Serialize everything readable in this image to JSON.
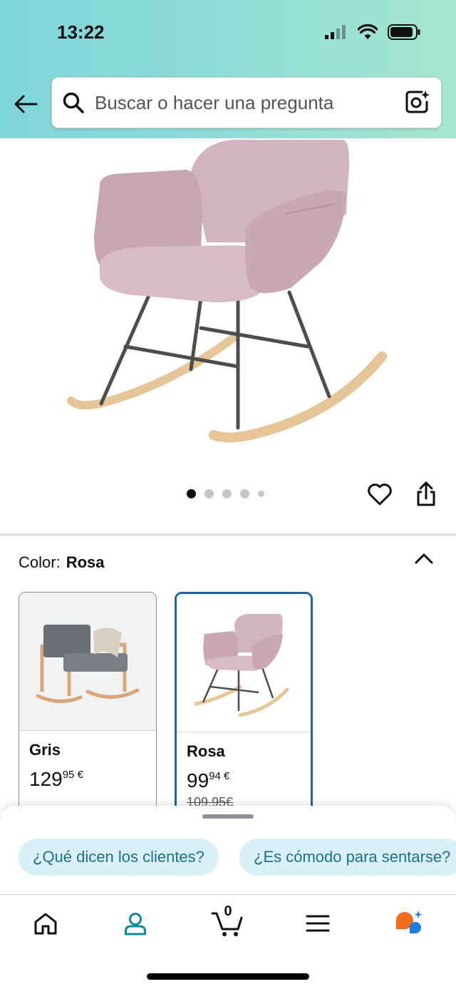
{
  "status_bar": {
    "time": "13:22"
  },
  "search": {
    "placeholder": "Buscar o hacer una pregunta"
  },
  "carousel": {
    "total_images": 5,
    "active_index": 0
  },
  "color_selector": {
    "label": "Color:",
    "selected": "Rosa"
  },
  "variants": [
    {
      "name": "Gris",
      "price_whole": "129",
      "price_fraction": "95",
      "currency": "€",
      "old_price": ""
    },
    {
      "name": "Rosa",
      "price_whole": "99",
      "price_fraction": "94",
      "currency": "€",
      "old_price": "109,95€"
    }
  ],
  "suggestions": [
    "¿Qué dicen los clientes?",
    "¿Es cómodo para sentarse?"
  ],
  "bottom_nav": {
    "cart_count": "0",
    "active": "profile"
  },
  "colors": {
    "accent_blue": "#2162a1",
    "chip_bg": "#d9f0f7",
    "chip_text": "#1f6f8b",
    "profile_teal": "#0e8aa0"
  }
}
